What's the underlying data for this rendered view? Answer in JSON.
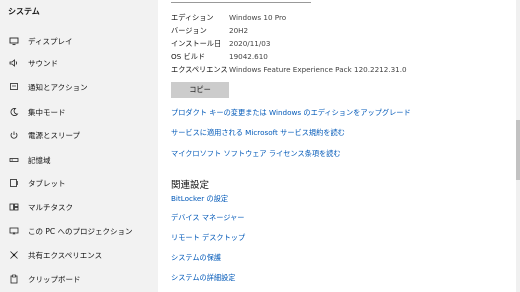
{
  "sidebar": {
    "title": "システム",
    "items": [
      {
        "label": "ディスプレイ",
        "icon": "display-icon"
      },
      {
        "label": "サウンド",
        "icon": "sound-icon"
      },
      {
        "label": "通知とアクション",
        "icon": "notification-icon"
      },
      {
        "label": "集中モード",
        "icon": "focus-moon-icon"
      },
      {
        "label": "電源とスリープ",
        "icon": "power-icon"
      },
      {
        "label": "記憶域",
        "icon": "storage-icon"
      },
      {
        "label": "タブレット",
        "icon": "tablet-icon"
      },
      {
        "label": "マルチタスク",
        "icon": "multitask-icon"
      },
      {
        "label": "この PC へのプロジェクション",
        "icon": "projection-icon"
      },
      {
        "label": "共有エクスペリエンス",
        "icon": "shared-experience-icon"
      },
      {
        "label": "クリップボード",
        "icon": "clipboard-icon"
      }
    ]
  },
  "specs": [
    {
      "key": "エディション",
      "value": "Windows 10 Pro"
    },
    {
      "key": "バージョン",
      "value": "20H2"
    },
    {
      "key": "インストール日",
      "value": "2020/11/03"
    },
    {
      "key": "OS ビルド",
      "value": "19042.610"
    },
    {
      "key": "エクスペリエンス",
      "value": "Windows Feature Experience Pack 120.2212.31.0"
    }
  ],
  "copy_button": "コピー",
  "links": [
    "プロダクト キーの変更または Windows のエディションをアップグレード",
    "サービスに適用される Microsoft サービス規約を読む",
    "マイクロソフト ソフトウェア ライセンス条項を読む"
  ],
  "related": {
    "title": "関連設定",
    "links": [
      "BitLocker の設定",
      "デバイス マネージャー",
      "リモート デスクトップ",
      "システムの保護",
      "システムの詳細設定"
    ]
  },
  "colors": {
    "link": "#0058b8",
    "sidebar_bg": "#f2f2f2",
    "button_bg": "#cccccc"
  }
}
